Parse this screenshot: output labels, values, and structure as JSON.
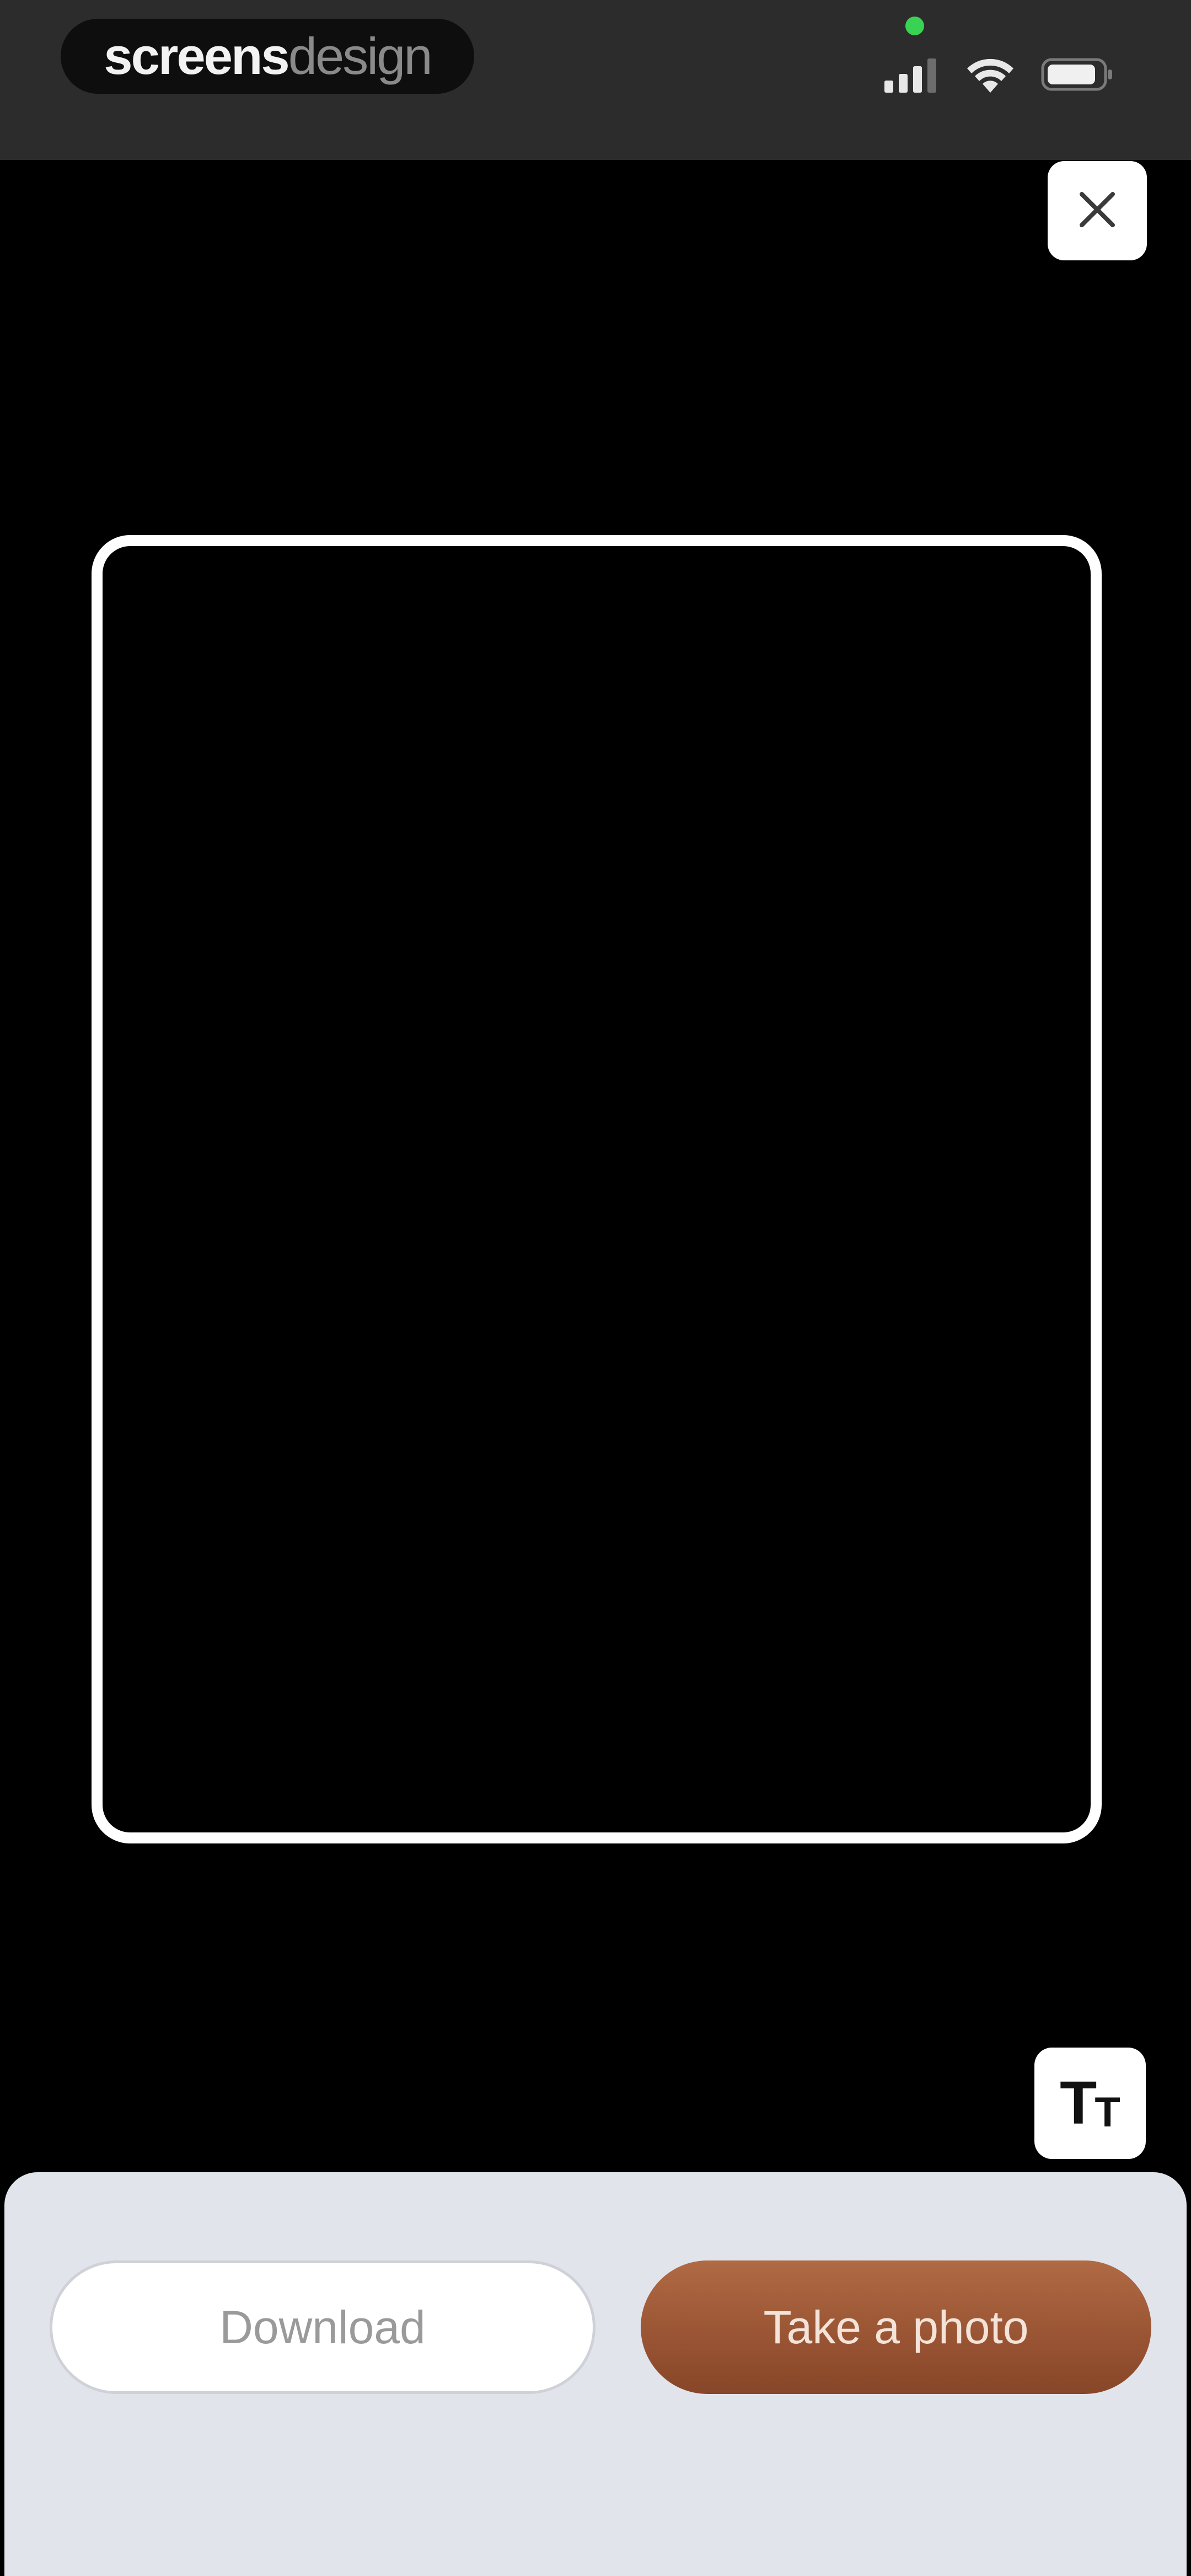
{
  "status_bar": {
    "brand_bold": "screens",
    "brand_light": "design",
    "icons": [
      "signal-icon",
      "wifi-icon",
      "battery-icon"
    ],
    "camera_indicator_color": "#39d353"
  },
  "toolbar": {
    "close_icon": "close-icon",
    "text_size_glyph_big": "T",
    "text_size_glyph_small": "T"
  },
  "actions": {
    "download_label": "Download",
    "take_photo_label": "Take a photo"
  },
  "colors": {
    "status_bar_bg": "#2c2c2c",
    "screen_bg": "#000000",
    "sheet_bg": "#e2e4ec",
    "accent": "#9a5534"
  }
}
